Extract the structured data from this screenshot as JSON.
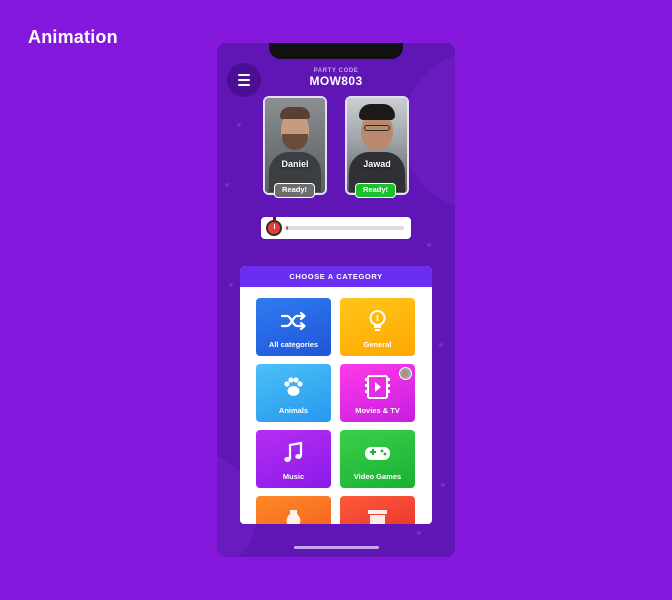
{
  "page_label": "Animation",
  "header": {
    "party_code_label": "PARTY CODE",
    "party_code": "MOW803"
  },
  "players": [
    {
      "name": "Daniel",
      "status": "Ready!",
      "status_color": "#6d6d6d"
    },
    {
      "name": "Jawad",
      "status": "Ready!",
      "status_color": "#18c02a"
    }
  ],
  "timer": {
    "progress": 0.02,
    "fill_color": "#e43c36"
  },
  "categories": {
    "title": "CHOOSE A CATEGORY",
    "items": [
      {
        "label": "All categories",
        "icon": "shuffle-icon"
      },
      {
        "label": "General",
        "icon": "lightbulb-icon"
      },
      {
        "label": "Animals",
        "icon": "paw-icon"
      },
      {
        "label": "Movies & TV",
        "icon": "film-play-icon"
      },
      {
        "label": "Music",
        "icon": "music-note-icon"
      },
      {
        "label": "Video Games",
        "icon": "gamepad-icon"
      }
    ]
  },
  "colors": {
    "background": "#8419dd",
    "phone": "#5f16b4",
    "header_accent": "#6b2ef0"
  }
}
